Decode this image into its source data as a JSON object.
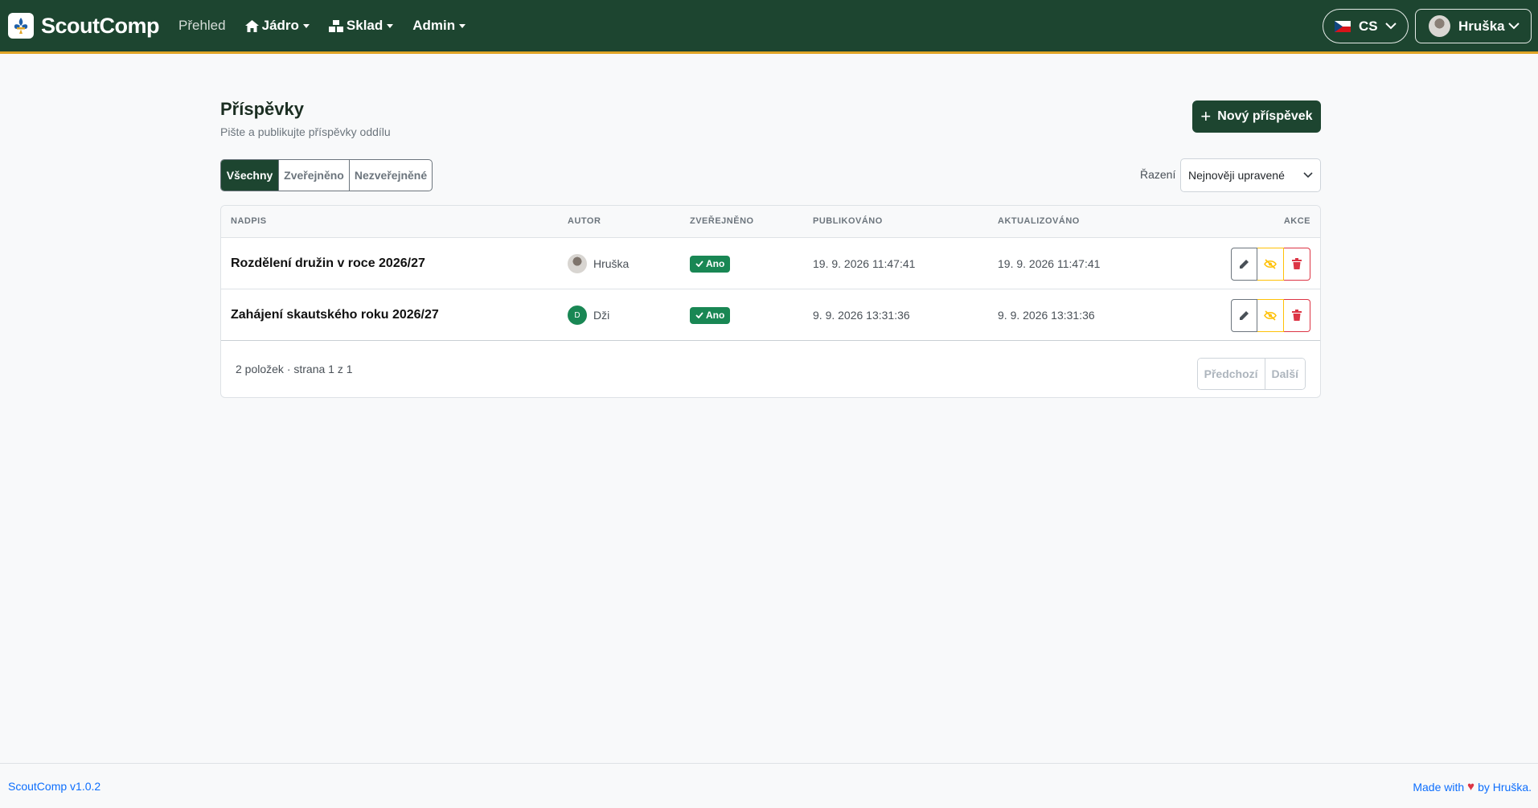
{
  "navbar": {
    "brand": "ScoutComp",
    "links": {
      "overview": "Přehled",
      "core": "Jádro",
      "warehouse": "Sklad",
      "admin": "Admin"
    },
    "language": "CS",
    "user": "Hruška"
  },
  "page": {
    "title": "Příspěvky",
    "subtitle": "Pište a publikujte příspěvky oddílu",
    "new_button": "Nový příspěvek"
  },
  "filters": {
    "tabs": [
      "Všechny",
      "Zveřejněno",
      "Nezveřejněné"
    ],
    "active": "Všechny",
    "sort_label": "Řazení",
    "sort_value": "Nejnověji upravené"
  },
  "table": {
    "headers": {
      "title": "NADPIS",
      "author": "AUTOR",
      "published": "ZVEŘEJNĚNO",
      "published_at": "PUBLIKOVÁNO",
      "updated_at": "AKTUALIZOVÁNO",
      "actions": "AKCE"
    },
    "rows": [
      {
        "title": "Rozdělení družin v roce 2026/27",
        "author": "Hruška",
        "published": "Ano",
        "published_at": "19. 9. 2026 11:47:41",
        "updated_at": "19. 9. 2026 11:47:41"
      },
      {
        "title": "Zahájení skautského roku 2026/27",
        "author": "Dži",
        "author_initial": "D",
        "published": "Ano",
        "published_at": "9. 9. 2026 13:31:36",
        "updated_at": "9. 9. 2026 13:31:36"
      }
    ],
    "footer": {
      "count": "2 položek · strana 1 z 1",
      "prev": "Předchozí",
      "next": "Další"
    }
  },
  "footer": {
    "version": "ScoutComp v1.0.2",
    "made_with": "Made with",
    "by": "by Hruška."
  },
  "colors": {
    "primary": "#1d4530",
    "accent": "#e0a526",
    "success": "#198754",
    "danger": "#dc3545",
    "warning": "#ffc107",
    "link": "#0d6efd"
  }
}
